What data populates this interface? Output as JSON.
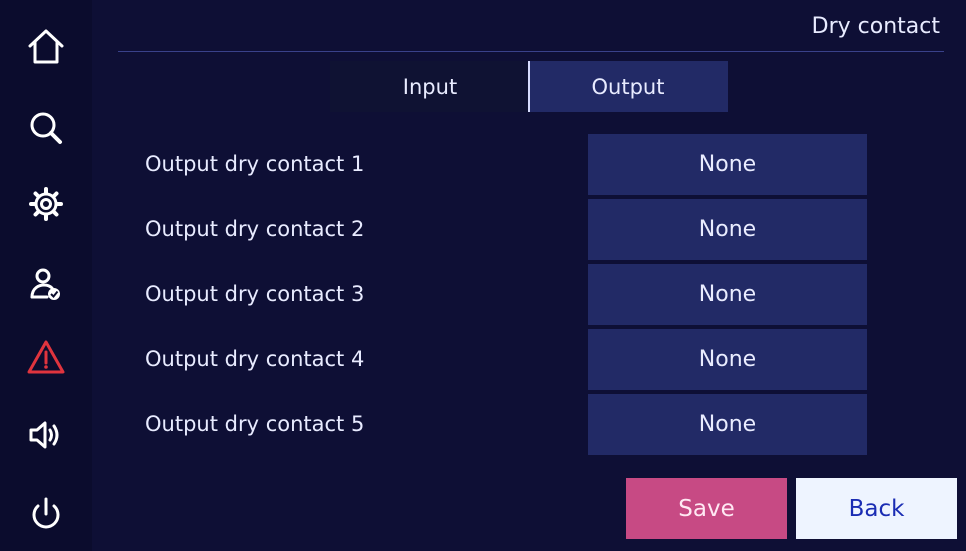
{
  "header": {
    "title": "Dry contact"
  },
  "tabs": [
    {
      "label": "Input",
      "active": false
    },
    {
      "label": "Output",
      "active": true
    }
  ],
  "rows": [
    {
      "label": "Output dry contact 1",
      "value": "None"
    },
    {
      "label": "Output dry contact 2",
      "value": "None"
    },
    {
      "label": "Output dry contact 3",
      "value": "None"
    },
    {
      "label": "Output dry contact 4",
      "value": "None"
    },
    {
      "label": "Output dry contact 5",
      "value": "None"
    }
  ],
  "buttons": {
    "save": "Save",
    "back": "Back"
  },
  "sidebar": {
    "items": [
      {
        "icon": "home-icon"
      },
      {
        "icon": "search-icon"
      },
      {
        "icon": "gear-icon"
      },
      {
        "icon": "user-check-icon"
      },
      {
        "icon": "warning-icon",
        "color": "#e0343e"
      },
      {
        "icon": "speaker-icon"
      },
      {
        "icon": "power-icon"
      }
    ]
  },
  "colors": {
    "background": "#0e0f35",
    "active_tab": "#222a66",
    "value_box": "#222a66",
    "save": "#c74a84",
    "back": "#eef4ff",
    "alert": "#e0343e"
  }
}
